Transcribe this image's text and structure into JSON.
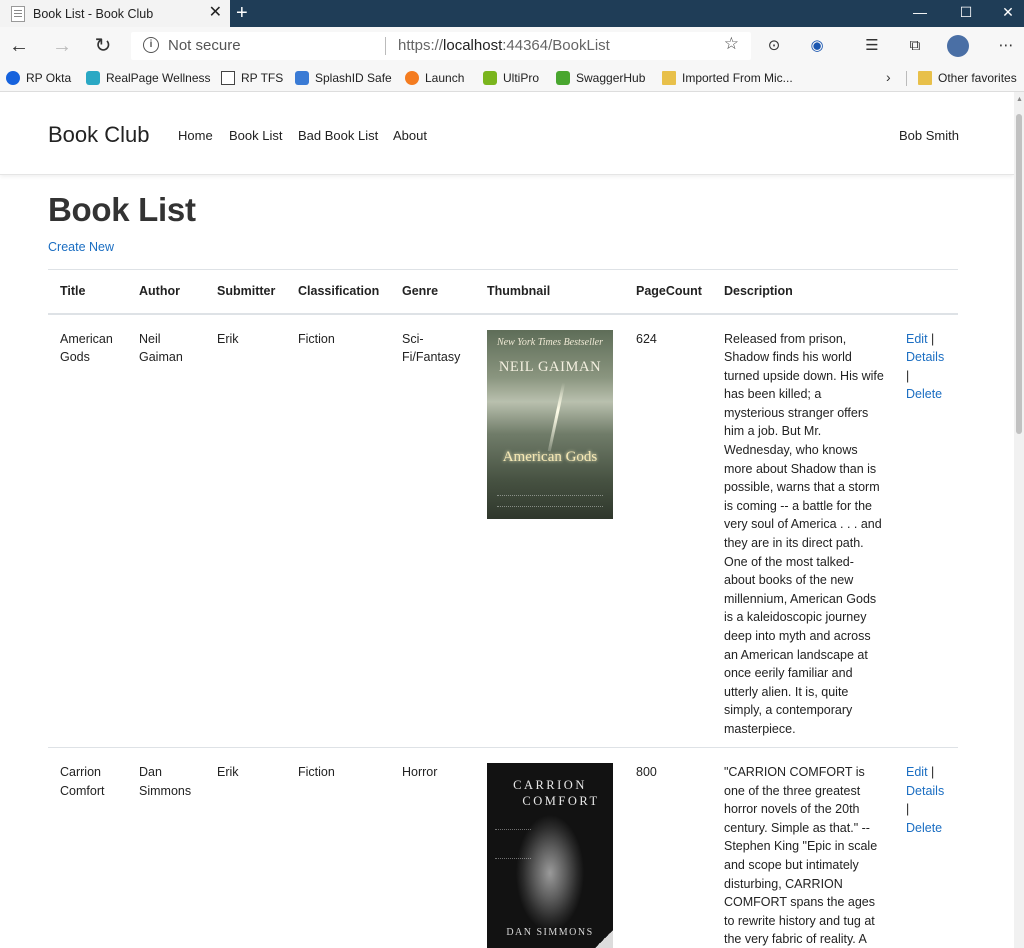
{
  "browser": {
    "tab_title": "Book List - Book Club",
    "tab_close": "✕",
    "new_tab": "+",
    "window_minimize": "—",
    "window_maximize": "☐",
    "window_close": "✕",
    "security_label": "Not secure",
    "url_prefix": "https://",
    "url_host": "localhost",
    "url_rest": ":44364/BookList",
    "bookmarks": [
      "RP Okta",
      "RealPage Wellness",
      "RP TFS",
      "SplashID Safe",
      "Launch",
      "UltiPro",
      "SwaggerHub",
      "Imported From Mic...",
      "Other favorites"
    ]
  },
  "site": {
    "brand": "Book Club",
    "nav": [
      "Home",
      "Book List",
      "Bad Book List",
      "About"
    ],
    "user": "Bob Smith"
  },
  "page": {
    "title": "Book List",
    "create_new": "Create New"
  },
  "table": {
    "headers": [
      "Title",
      "Author",
      "Submitter",
      "Classification",
      "Genre",
      "Thumbnail",
      "PageCount",
      "Description"
    ],
    "rows": [
      {
        "title": "American Gods",
        "author": "Neil Gaiman",
        "submitter": "Erik",
        "classification": "Fiction",
        "genre": "Sci-Fi/Fantasy",
        "page_count": "624",
        "description": "Released from prison, Shadow finds his world turned upside down. His wife has been killed; a mysterious stranger offers him a job. But Mr. Wednesday, who knows more about Shadow than is possible, warns that a storm is coming -- a battle for the very soul of America . . . and they are in its direct path. One of the most talked-about books of the new millennium, American Gods is a kaleidoscopic journey deep into myth and across an American landscape at once eerily familiar and utterly alien. It is, quite simply, a contemporary masterpiece.",
        "cover": {
          "banner": "New York Times Bestseller",
          "author": "NEIL GAIMAN",
          "title": "American Gods"
        },
        "actions": {
          "edit": "Edit",
          "details": "Details",
          "delete": "Delete",
          "sep": "|"
        }
      },
      {
        "title": "Carrion Comfort",
        "author": "Dan Simmons",
        "submitter": "Erik",
        "classification": "Fiction",
        "genre": "Horror",
        "page_count": "800",
        "description": "\"CARRION COMFORT is one of the three greatest horror novels of the 20th century. Simple as that.\" --Stephen King \"Epic in scale and scope but intimately disturbing, CARRION COMFORT spans the ages to rewrite history and tug at the very fabric of reality. A",
        "cover": {
          "title_line1": "CARRION",
          "title_line2": "COMFORT",
          "author": "DAN SIMMONS"
        },
        "actions": {
          "edit": "Edit",
          "details": "Details",
          "delete": "Delete",
          "sep": "|"
        }
      }
    ]
  },
  "colors": {
    "titlebar": "#1f3d57",
    "link": "#1b6ec2",
    "border": "#dee2e6"
  }
}
